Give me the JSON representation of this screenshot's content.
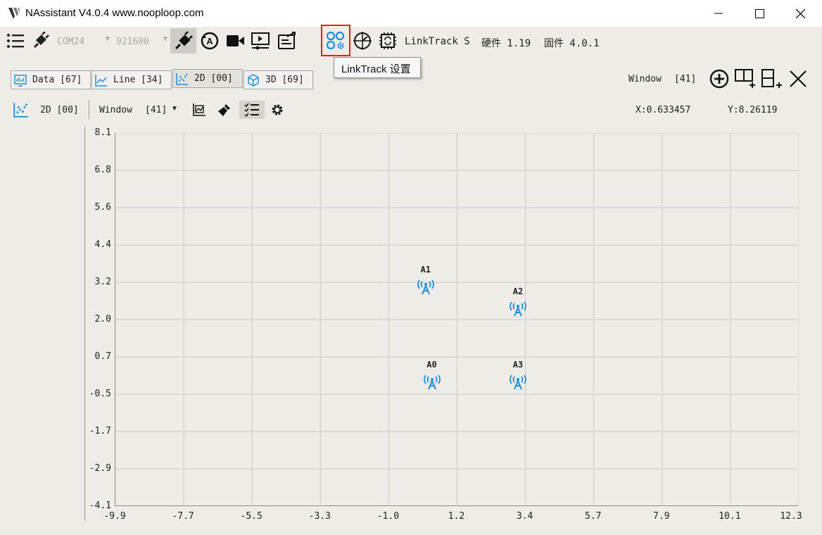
{
  "window": {
    "title": "NAssistant V4.0.4   www.nooploop.com",
    "controls": [
      "minimize-icon",
      "maximize-icon",
      "close-icon"
    ]
  },
  "toolbar": {
    "port": "COM24",
    "baud": "921600",
    "device_name": "LinkTrack S",
    "hardware": "硬件 1.19",
    "firmware": "固件 4.0.1",
    "tooltip": "LinkTrack 设置",
    "highlight_color": "#e02020",
    "icons": [
      "menu-icon",
      "plug-icon",
      "connect-icon",
      "auto-baud-icon",
      "video-record-icon",
      "playback-icon",
      "export-icon",
      "linktrack-settings-icon",
      "calibration-icon",
      "firmware-update-icon"
    ]
  },
  "tabs": [
    {
      "label": "Data [67]",
      "icon": "data-icon"
    },
    {
      "label": "Line [34]",
      "icon": "line-chart-icon"
    },
    {
      "label": "2D [00]",
      "icon": "scatter-icon",
      "active": true
    },
    {
      "label": "3D [69]",
      "icon": "cube-icon"
    }
  ],
  "window_panel": {
    "label": "Window",
    "count": "[41]",
    "icons": [
      "add-window-icon",
      "split-horizontal-icon",
      "split-vertical-icon",
      "close-window-icon"
    ]
  },
  "view_toolbar": {
    "title": "2D [00]",
    "window_label": "Window",
    "window_count": "[41]",
    "coord_x": "X:0.633457",
    "coord_y": "Y:8.26119",
    "icons": [
      "scatter-icon",
      "dropdown-arrow-icon",
      "fit-view-icon",
      "clear-brush-icon",
      "list-check-icon",
      "settings-gear-icon"
    ]
  },
  "chart_data": {
    "type": "scatter",
    "x_ticks": [
      "-9.9",
      "-7.7",
      "-5.5",
      "-3.3",
      "-1.0",
      "1.2",
      "3.4",
      "5.7",
      "7.9",
      "10.1",
      "12.3"
    ],
    "y_ticks": [
      "8.1",
      "6.8",
      "5.6",
      "4.4",
      "3.2",
      "2.0",
      "0.7",
      "-0.5",
      "-1.7",
      "-2.9",
      "-4.1"
    ],
    "xlim": [
      -9.9,
      12.3
    ],
    "ylim": [
      -4.1,
      8.1
    ],
    "grid": true,
    "anchor_color": "#1a8fe0",
    "points": [
      {
        "label": "A1",
        "x": 0.2,
        "y": 3.1
      },
      {
        "label": "A2",
        "x": 3.2,
        "y": 2.4
      },
      {
        "label": "A0",
        "x": 0.4,
        "y": 0.0
      },
      {
        "label": "A3",
        "x": 3.2,
        "y": 0.0
      }
    ]
  }
}
